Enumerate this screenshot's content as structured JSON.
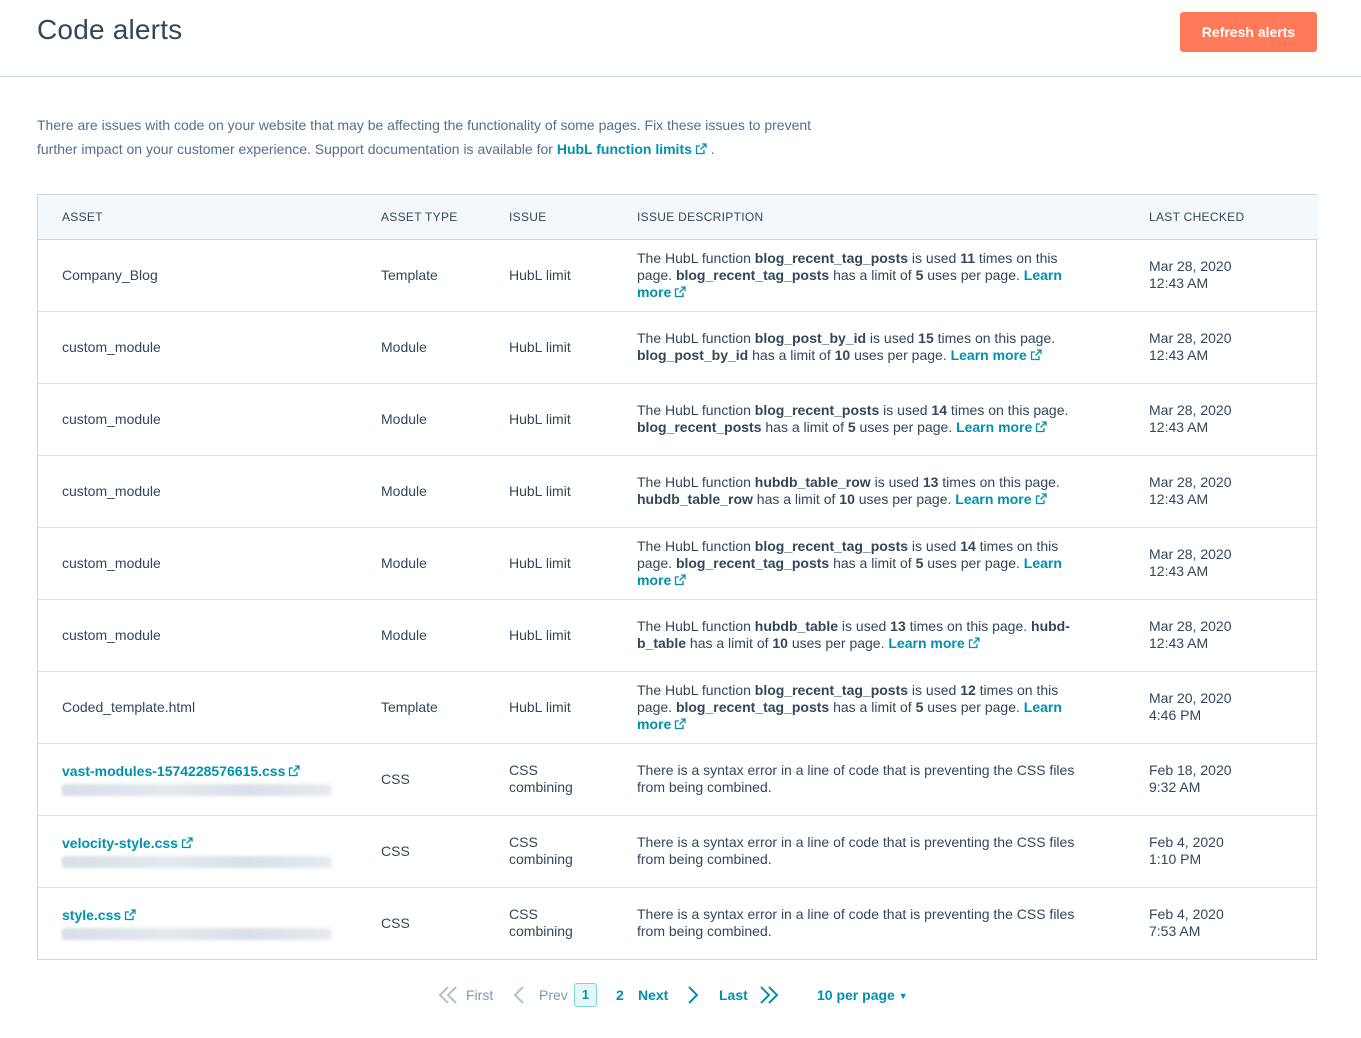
{
  "header": {
    "title": "Code alerts",
    "refresh_label": "Refresh alerts"
  },
  "intro": {
    "text_before_link": "There are issues with code on your website that may be affecting the functionality of some pages. Fix these issues to prevent further impact on your customer experience. Support documentation is available for ",
    "link_label": "HubL function limits",
    "text_after_link": " ."
  },
  "table": {
    "columns": [
      "ASSET",
      "ASSET TYPE",
      "ISSUE",
      "ISSUE DESCRIPTION",
      "LAST CHECKED"
    ],
    "learn_more_label": "Learn more",
    "rows": [
      {
        "asset": "Company_Blog",
        "asset_link": false,
        "type": "Template",
        "issue": "HubL limit",
        "func": "blog_recent_tag_posts",
        "used": "11",
        "limit": "5",
        "date": "Mar 28, 2020",
        "time": "12:43 AM"
      },
      {
        "asset": "custom_module",
        "asset_link": false,
        "type": "Module",
        "issue": "HubL limit",
        "func": "blog_post_by_id",
        "used": "15",
        "limit": "10",
        "date": "Mar 28, 2020",
        "time": "12:43 AM"
      },
      {
        "asset": "custom_module",
        "asset_link": false,
        "type": "Module",
        "issue": "HubL limit",
        "func": "blog_recent_posts",
        "used": "14",
        "limit": "5",
        "date": "Mar 28, 2020",
        "time": "12:43 AM"
      },
      {
        "asset": "custom_module",
        "asset_link": false,
        "type": "Module",
        "issue": "HubL limit",
        "func": "hubdb_table_row",
        "used": "13",
        "limit": "10",
        "date": "Mar 28, 2020",
        "time": "12:43 AM"
      },
      {
        "asset": "custom_module",
        "asset_link": false,
        "type": "Module",
        "issue": "HubL limit",
        "func": "blog_recent_tag_posts",
        "used": "14",
        "limit": "5",
        "date": "Mar 28, 2020",
        "time": "12:43 AM"
      },
      {
        "asset": "custom_module",
        "asset_link": false,
        "type": "Module",
        "issue": "HubL limit",
        "func": "hubdb_table",
        "func_wrapped": "hubd-b_table",
        "used": "13",
        "limit": "10",
        "date": "Mar 28, 2020",
        "time": "12:43 AM"
      },
      {
        "asset": "Coded_template.html",
        "asset_link": false,
        "type": "Template",
        "issue": "HubL limit",
        "func": "blog_recent_tag_posts",
        "used": "12",
        "limit": "5",
        "date": "Mar 20, 2020",
        "time": "4:46 PM"
      },
      {
        "asset": "vast-modules-1574228576615.css",
        "asset_link": true,
        "type": "CSS",
        "issue": "CSS combining",
        "description": "There is a syntax error in a line of code that is preventing the CSS files from being combined.",
        "date": "Feb 18, 2020",
        "time": "9:32 AM"
      },
      {
        "asset": "velocity-style.css",
        "asset_link": true,
        "type": "CSS",
        "issue": "CSS combining",
        "description": "There is a syntax error in a line of code that is preventing the CSS files from being combined.",
        "date": "Feb 4, 2020",
        "time": "1:10 PM"
      },
      {
        "asset": "style.css",
        "asset_link": true,
        "type": "CSS",
        "issue": "CSS combining",
        "description": "There is a syntax error in a line of code that is preventing the CSS files from being combined.",
        "date": "Feb 4, 2020",
        "time": "7:53 AM"
      }
    ]
  },
  "pagination": {
    "first_label": "First",
    "prev_label": "Prev",
    "current_page": "1",
    "page_2": "2",
    "next_label": "Next",
    "last_label": "Last",
    "per_page_label": "10 per page"
  },
  "colors": {
    "accent": "#ff7a59",
    "link": "#0091ae",
    "text": "#33475b",
    "muted": "#7c98b6"
  }
}
